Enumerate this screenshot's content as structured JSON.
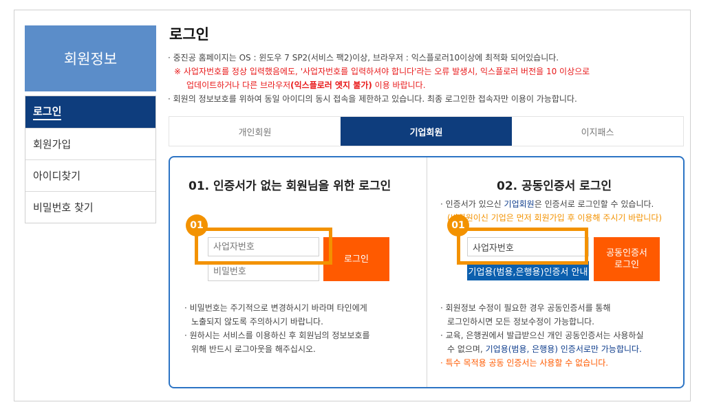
{
  "sidebar": {
    "title": "회원정보",
    "items": [
      {
        "label": "로그인"
      },
      {
        "label": "회원가입"
      },
      {
        "label": "아이디찾기"
      },
      {
        "label": "비밀번호 찾기"
      }
    ]
  },
  "page_title": "로그인",
  "notes": {
    "line1": "· 중진공 홈페이지는 OS : 윈도우 7 SP2(서비스 팩2)이상, 브라우저 : 익스플로러10이상에 최적화 되어있습니다.",
    "warn1": "※ 사업자번호를 정상 입력했음에도, '사업자번호를 입력하셔야 합니다'라는 오류 발생시, 익스플로러 버전을 10 이상으로",
    "warn2_a": "업데이트하거나 다른 브라우저",
    "warn2_b": "(익스플로러 엣지 불가)",
    "warn2_c": " 이용 바랍니다.",
    "line3": "· 회원의 정보보호를 위하여 동일 아이디의 동시 접속을 제한하고 있습니다. 최종 로그인한 접속자만 이용이 가능합니다."
  },
  "tabs": [
    {
      "label": "개인회원"
    },
    {
      "label": "기업회원"
    },
    {
      "label": "이지패스"
    }
  ],
  "left_box": {
    "title": "01. 인증서가 없는 회원님을 위한 로그인",
    "badge": "01",
    "bizno_placeholder": "사업자번호",
    "password_placeholder": "비밀번호",
    "login_button": "로그인",
    "desc1": "· 비밀번호는 주기적으로 변경하시기 바라며 타인에게",
    "desc1b": "노출되지 않도록 주의하시기 바랍니다.",
    "desc2": "· 원하시는 서비스를 이용하신 후 회원님의 정보보호를",
    "desc2b": "위해 반드시 로그아웃을 해주십시오."
  },
  "right_box": {
    "title": "02. 공동인증서 로그인",
    "badge": "01",
    "info1_a": "· 인증서가 있으신 ",
    "info1_b": "기업회원",
    "info1_c": "은 인증서로 로그인할 수 있습니다.",
    "info2": "(비회원이신 기업은 먼저 회원가입 후 이용해 주시기 바랍니다)",
    "bizno_value": "사업자번호",
    "guide_button": "기업용(범용,은행용)인증서 안내",
    "cert_button_1": "공동인증서",
    "cert_button_2": "로그인",
    "desc1": "· 회원정보 수정이 필요한 경우 공동인증서를 통해",
    "desc1b": "로그인하시면 모든 정보수정이 가능합니다.",
    "desc2": "· 교육, 은행권에서 발급받으신 개인 공동인증서는 사용하실",
    "desc2b_a": "수 없으며, ",
    "desc2b_b": "기업용(범용, 은행용) 인증서로만 가능합니다.",
    "desc3": "· 특수 목적용 공동 인증서는 사용할 수 없습니다."
  },
  "colors": {
    "navy": "#0e3d7d",
    "sidebar_head": "#5b8dc9",
    "orange_button": "#ff5a00",
    "highlight": "#f39200",
    "panel_border": "#2b73c4"
  }
}
